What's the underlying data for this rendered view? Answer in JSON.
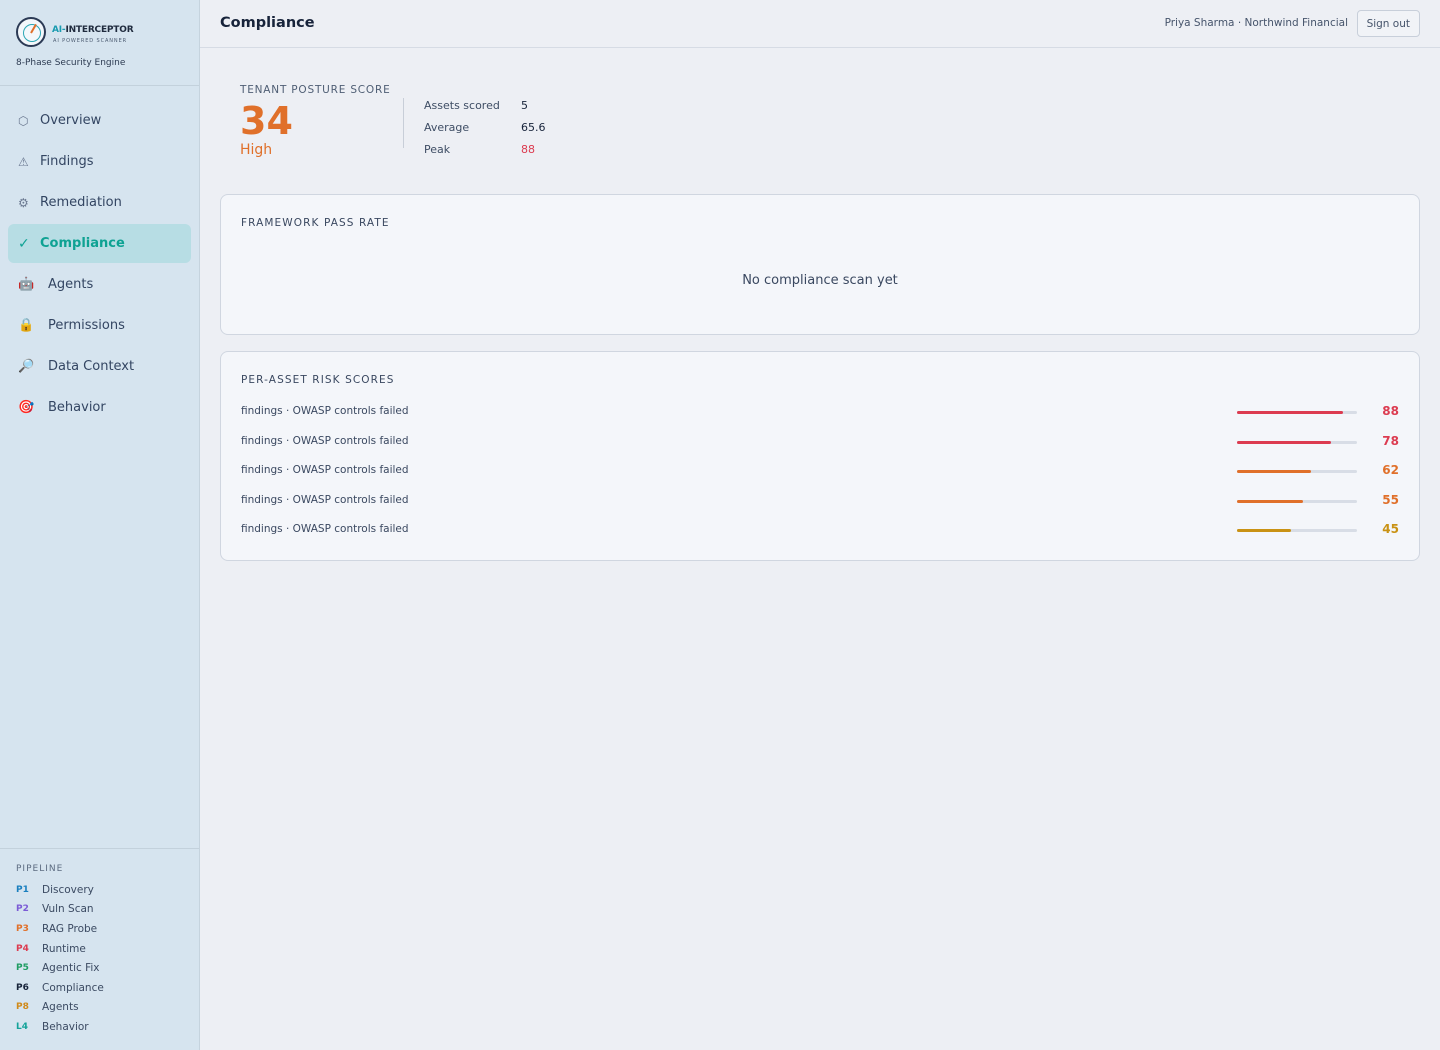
{
  "brand": {
    "name_prefix": "AI-",
    "name_suffix": "INTERCEPTOR",
    "tagline": "AI POWERED SCANNER",
    "engine": "8-Phase Security Engine"
  },
  "nav": [
    {
      "label": "Overview",
      "icon": "hexagon-icon",
      "glyph": "⬡",
      "active": false
    },
    {
      "label": "Findings",
      "icon": "warning-icon",
      "glyph": "⚠",
      "active": false
    },
    {
      "label": "Remediation",
      "icon": "gear-icon",
      "glyph": "⚙",
      "active": false
    },
    {
      "label": "Compliance",
      "icon": "check-icon",
      "glyph": "✓",
      "active": true
    },
    {
      "label": "Agents",
      "icon": "robot-icon",
      "glyph": "🤖",
      "active": false
    },
    {
      "label": "Permissions",
      "icon": "lock-icon",
      "glyph": "🔒",
      "active": false
    },
    {
      "label": "Data Context",
      "icon": "magnifier-icon",
      "glyph": "🔎",
      "active": false
    },
    {
      "label": "Behavior",
      "icon": "target-icon",
      "glyph": "🎯",
      "active": false
    }
  ],
  "pipeline": {
    "title": "PIPELINE",
    "items": [
      {
        "code": "P1",
        "label": "Discovery",
        "color": "#1a7fbf"
      },
      {
        "code": "P2",
        "label": "Vuln Scan",
        "color": "#7b5bd6"
      },
      {
        "code": "P3",
        "label": "RAG Probe",
        "color": "#e0702a"
      },
      {
        "code": "P4",
        "label": "Runtime",
        "color": "#dc3b50"
      },
      {
        "code": "P5",
        "label": "Agentic Fix",
        "color": "#1f9d63"
      },
      {
        "code": "P6",
        "label": "Compliance",
        "color": "#17233a"
      },
      {
        "code": "P8",
        "label": "Agents",
        "color": "#d08a1a"
      },
      {
        "code": "L4",
        "label": "Behavior",
        "color": "#15a39a"
      }
    ]
  },
  "header": {
    "title": "Compliance",
    "user": "Priya Sharma · Northwind Financial",
    "signout_label": "Sign out"
  },
  "posture": {
    "label": "TENANT POSTURE SCORE",
    "score": "34",
    "level": "High",
    "stats": [
      {
        "label": "Assets scored",
        "value": "5",
        "highlight": false
      },
      {
        "label": "Average",
        "value": "65.6",
        "highlight": false
      },
      {
        "label": "Peak",
        "value": "88",
        "highlight": true
      }
    ]
  },
  "framework": {
    "title": "FRAMEWORK PASS RATE",
    "empty_text": "No compliance scan yet"
  },
  "risk": {
    "title": "PER-ASSET RISK SCORES",
    "rows": [
      {
        "label": "findings · OWASP controls failed",
        "score": 88,
        "color": "#dc3b50"
      },
      {
        "label": "findings · OWASP controls failed",
        "score": 78,
        "color": "#dc3b50"
      },
      {
        "label": "findings · OWASP controls failed",
        "score": 62,
        "color": "#e0702a"
      },
      {
        "label": "findings · OWASP controls failed",
        "score": 55,
        "color": "#e0702a"
      },
      {
        "label": "findings · OWASP controls failed",
        "score": 45,
        "color": "#c99214"
      }
    ]
  }
}
